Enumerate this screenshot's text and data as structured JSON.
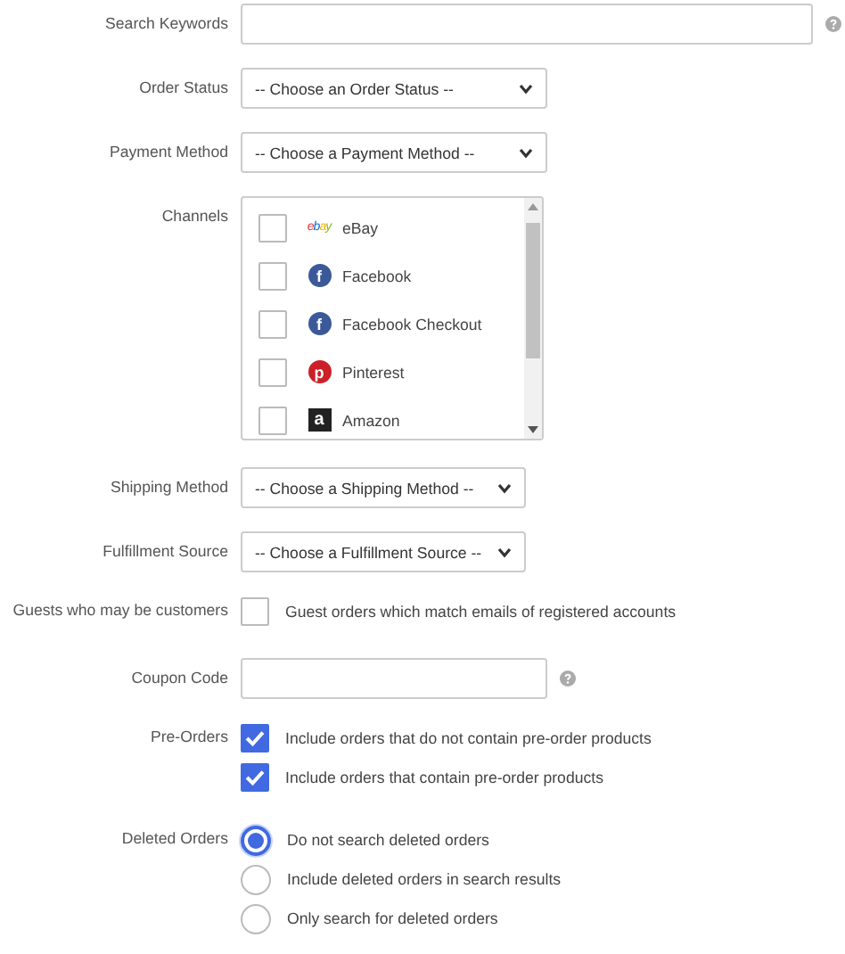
{
  "rows": [
    {
      "kind": "text",
      "label": "Search Keywords",
      "value": "",
      "help_icon": true
    },
    {
      "kind": "select",
      "label": "Order Status",
      "value": "-- Choose an Order Status --"
    },
    {
      "kind": "select",
      "label": "Payment Method",
      "value": "-- Choose a Payment Method --"
    },
    {
      "kind": "listbox",
      "label": "Channels",
      "items": [
        {
          "label": "eBay",
          "checked": false,
          "kind": "wordmark",
          "logo_text": "ebay"
        },
        {
          "label": "Facebook",
          "checked": false,
          "kind": "circle",
          "color": "#3b5998",
          "logo_text": "f"
        },
        {
          "label": "Facebook Checkout",
          "checked": false,
          "kind": "circle",
          "color": "#3b5998",
          "logo_text": "f"
        },
        {
          "label": "Pinterest",
          "checked": false,
          "kind": "circle",
          "color": "#cb2027",
          "logo_text": "p"
        },
        {
          "label": "Amazon",
          "checked": false,
          "kind": "square",
          "color": "#222222",
          "logo_text": "a"
        }
      ]
    },
    {
      "kind": "select",
      "label": "Shipping Method",
      "value": "-- Choose a Shipping Method --"
    },
    {
      "kind": "select",
      "label": "Fulfillment Source",
      "value": "-- Choose a Fulfillment Source --"
    },
    {
      "kind": "checks",
      "label": "Guests who may be customers",
      "items": [
        {
          "label": "Guest orders which match emails of registered accounts",
          "checked": false
        }
      ]
    },
    {
      "kind": "text",
      "label": "Coupon Code",
      "value": "",
      "help_icon": true
    },
    {
      "kind": "checks",
      "label": "Pre-Orders",
      "items": [
        {
          "label": "Include orders that do not contain pre-order products",
          "checked": true
        },
        {
          "label": "Include orders that contain pre-order products",
          "checked": true
        }
      ]
    },
    {
      "kind": "radios",
      "label": "Deleted Orders",
      "items": [
        {
          "label": "Do not search deleted orders",
          "selected": true
        },
        {
          "label": "Include deleted orders in search results",
          "selected": false
        },
        {
          "label": "Only search for deleted orders",
          "selected": false
        }
      ]
    }
  ]
}
